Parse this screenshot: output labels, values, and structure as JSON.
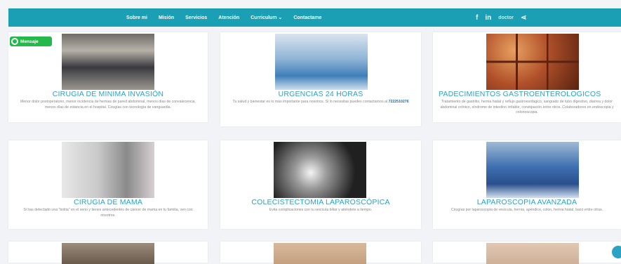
{
  "nav": {
    "items": [
      "Sobre mi",
      "Misión",
      "Servicios",
      "Atención",
      "Curriculum ⌄",
      "Contactame"
    ],
    "social": {
      "facebook": "f",
      "linkedin": "in",
      "doctoralia": "doctor",
      "share": "⋖"
    }
  },
  "whatsapp": {
    "label": "Mensaje",
    "color": "#25b84a"
  },
  "cards": [
    {
      "title": "CIRUGIA DE MINIMA INVASIÓN",
      "desc": "Menor dolor postoperatorio, menor incidencia de hernias de pared abdominal, menos días de convalecencia, menos días de estancia en el hospital. Cirugías con tecnología de vanguardia.",
      "image_icon": "laparoscopy-tower"
    },
    {
      "title": "URGENCIAS 24 HORAS",
      "desc": "Tu salud y bienestar es lo más importante para nosotros. Si lo necesitas puedes contactarnos al",
      "phone": "7222510276",
      "image_icon": "emergency-team"
    },
    {
      "title": "PADECIMIENTOS GASTROENTEROLOGICOS",
      "desc": "Tratamiento de gastritis, hernia hiatal y reflujo gastroesofágico, sangrado de tubo digestivo, diarrea y dolor abdominal crónico, síndrome de intestino irritable, constipación entre otros. Colaboradores en endoscopia y colonoscopia.",
      "image_icon": "endoscopy-grid"
    },
    {
      "title": "CIRUGIA DE MAMA",
      "desc": "Si has detectado una \"bolita\" en el seno y tienes antecedentes de cáncer de mama en tu familia, ven con nosotros.",
      "image_icon": "pink-ribbon"
    },
    {
      "title": "COLECISTECTOMIA LAPAROSCÓPICA",
      "desc": "Evita complicaciones con tu vesícula biliar y atiéndete a tiempo.",
      "image_icon": "cholangiogram"
    },
    {
      "title": "LAPAROSCOPIA AVANZADA",
      "desc": "Cirugías por laparoscopia de vesícula, hernia, apéndice, colon, hernia hiatal, bazo entre otras.",
      "image_icon": "surgery-team"
    }
  ],
  "colors": {
    "navbar": "#1a9fb4",
    "title": "#2aa3c4",
    "phone": "#1a6fa8"
  }
}
